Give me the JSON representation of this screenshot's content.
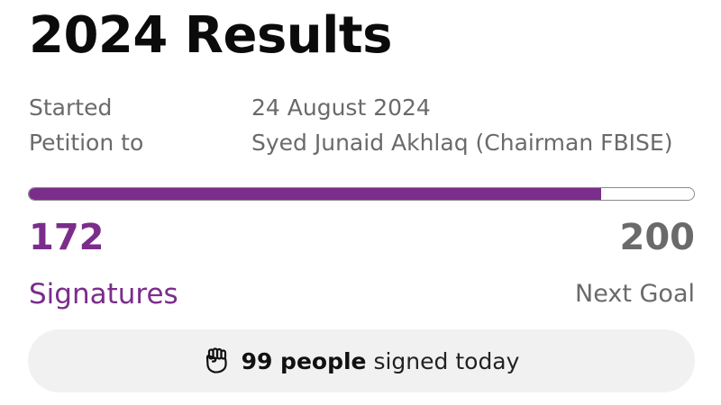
{
  "header": {
    "title": "2024 Results"
  },
  "details": {
    "started_label": "Started",
    "started_value": "24 August 2024",
    "petition_label": "Petition to",
    "petition_value": "Syed Junaid Akhlaq (Chairman FBISE)"
  },
  "progress": {
    "signatures": "172",
    "signatures_label": "Signatures",
    "goal": "200",
    "goal_label": "Next Goal",
    "fraction": 0.86
  },
  "today": {
    "icon": "raised-fist-icon",
    "count_text": "99 people",
    "suffix_text": " signed today"
  },
  "colors": {
    "accent": "#7b2d8b",
    "muted_text": "#6a6a6a",
    "pill_background": "#f1f1f1"
  }
}
